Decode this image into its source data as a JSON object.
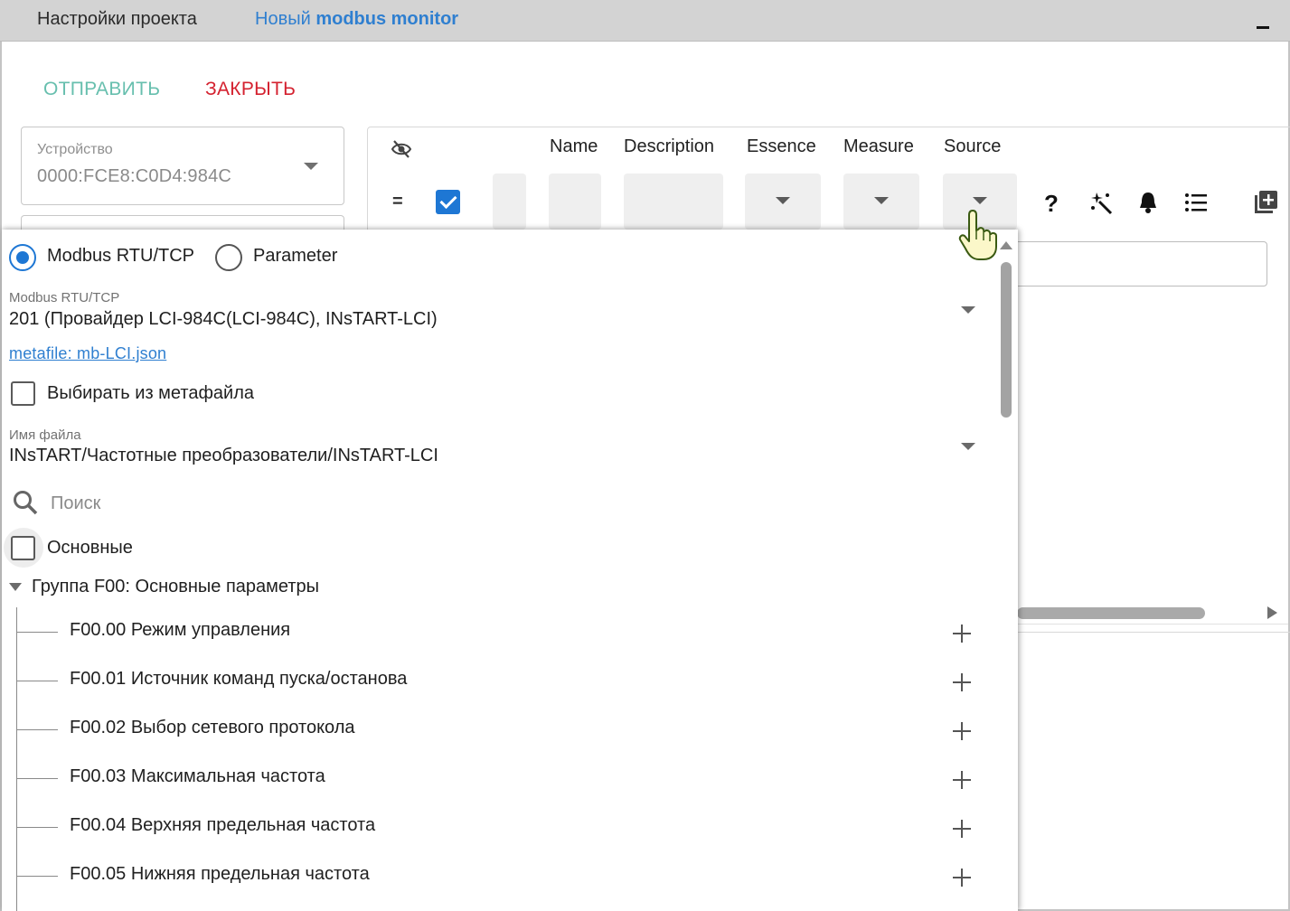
{
  "header": {
    "settings_tab": "Настройки проекта",
    "monitor_tab_prefix": "Новый",
    "monitor_tab_name": "modbus monitor"
  },
  "actions": {
    "send_label": "ОТПРАВИТЬ",
    "close_label": "ЗАКРЫТЬ"
  },
  "device": {
    "label": "Устройство",
    "value": "0000:FCE8:C0D4:984C"
  },
  "table": {
    "columns": [
      "Name",
      "Description",
      "Essence",
      "Measure",
      "Source"
    ],
    "equals_symbol": "=",
    "toolbar_icons": [
      "help-icon",
      "magic-wand-icon",
      "bell-icon",
      "list-icon",
      "add-box-icon"
    ]
  },
  "source_dropdown": {
    "radio_options": [
      {
        "label": "Modbus RTU/TCP",
        "selected": true
      },
      {
        "label": "Parameter",
        "selected": false
      }
    ],
    "modbus_caption": "Modbus RTU/TCP",
    "modbus_value": "201 (Провайдер LCI-984C(LCI-984C), INsTART-LCI)",
    "metafile_link": "metafile: mb-LCI.json",
    "choose_from_metafile_label": "Выбирать из метафайла",
    "filename_caption": "Имя файла",
    "filename_value": "INsTART/Частотные преобразователи/INsTART-LCI",
    "search_placeholder": "Поиск",
    "basic_label": "Основные",
    "group_label": "Группа F00: Основные параметры",
    "parameters": [
      "F00.00 Режим управления",
      "F00.01 Источник команд пуска/останова",
      "F00.02 Выбор сетевого протокола",
      "F00.03 Максимальная частота",
      "F00.04 Верхняя предельная частота",
      "F00.05 Нижняя предельная частота"
    ]
  },
  "colors": {
    "accent_blue": "#1e77d4",
    "send_green": "#67bfae",
    "close_red": "#d4212f",
    "header_gray": "#d3d3d3"
  }
}
